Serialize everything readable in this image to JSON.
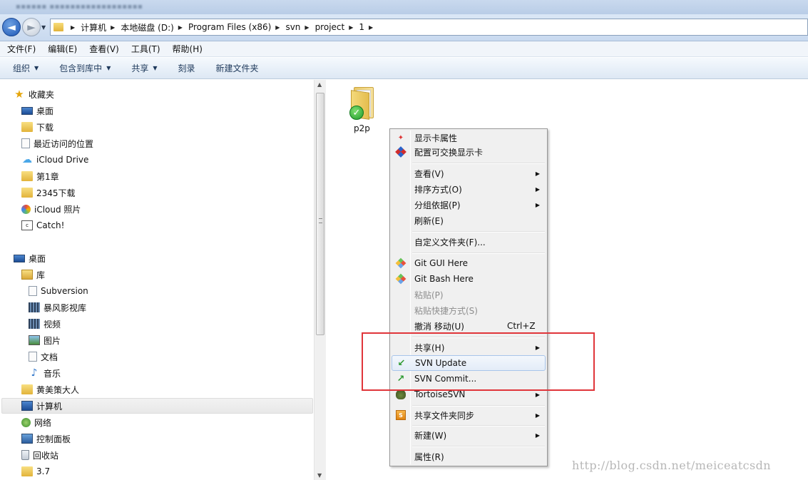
{
  "address": {
    "crumbs": [
      "计算机",
      "本地磁盘 (D:)",
      "Program Files (x86)",
      "svn",
      "project",
      "1"
    ]
  },
  "menubar": {
    "items": [
      "文件(F)",
      "编辑(E)",
      "查看(V)",
      "工具(T)",
      "帮助(H)"
    ]
  },
  "commandbar": {
    "items": [
      "组织",
      "包含到库中",
      "共享",
      "刻录",
      "新建文件夹"
    ]
  },
  "navpane": {
    "favorites": {
      "label": "收藏夹",
      "items": [
        "桌面",
        "下载",
        "最近访问的位置",
        "iCloud Drive",
        "第1章",
        "2345下载",
        "iCloud 照片",
        "Catch!"
      ]
    },
    "desktop": {
      "label": "桌面",
      "library_label": "库",
      "library_items": [
        "Subversion",
        "暴风影视库",
        "视频",
        "图片",
        "文档",
        "音乐"
      ],
      "items": [
        "黄美策大人",
        "计算机",
        "网络",
        "控制面板",
        "回收站",
        "3.7"
      ]
    }
  },
  "content": {
    "files": [
      {
        "name": "p2p",
        "status": "svn-normal"
      }
    ]
  },
  "context_menu": {
    "items": [
      {
        "label": "显示卡属性",
        "icon": "nvidia-icon"
      },
      {
        "label": "配置可交换显示卡",
        "icon": "switchable-graphics-icon"
      },
      {
        "label": "查看(V)"
      },
      {
        "label": "排序方式(O)"
      },
      {
        "label": "分组依据(P)"
      },
      {
        "label": "刷新(E)"
      },
      {
        "label": "自定义文件夹(F)..."
      },
      {
        "label": "Git GUI Here",
        "icon": "git-icon"
      },
      {
        "label": "Git Bash Here",
        "icon": "git-icon"
      },
      {
        "label": "粘贴(P)",
        "disabled": true
      },
      {
        "label": "粘贴快捷方式(S)",
        "disabled": true
      },
      {
        "label": "撤消 移动(U)",
        "shortcut": "Ctrl+Z"
      },
      {
        "label": "共享(H)"
      },
      {
        "label": "SVN Update",
        "icon": "svn-update-icon"
      },
      {
        "label": "SVN Commit...",
        "icon": "svn-commit-icon"
      },
      {
        "label": "TortoiseSVN",
        "icon": "tortoise-icon"
      },
      {
        "label": "共享文件夹同步",
        "icon": "folder-sync-icon"
      },
      {
        "label": "新建(W)"
      },
      {
        "label": "属性(R)"
      }
    ]
  },
  "annotation": {
    "color": "#e0353a"
  },
  "watermark": "http://blog.csdn.net/meiceatcsdn"
}
